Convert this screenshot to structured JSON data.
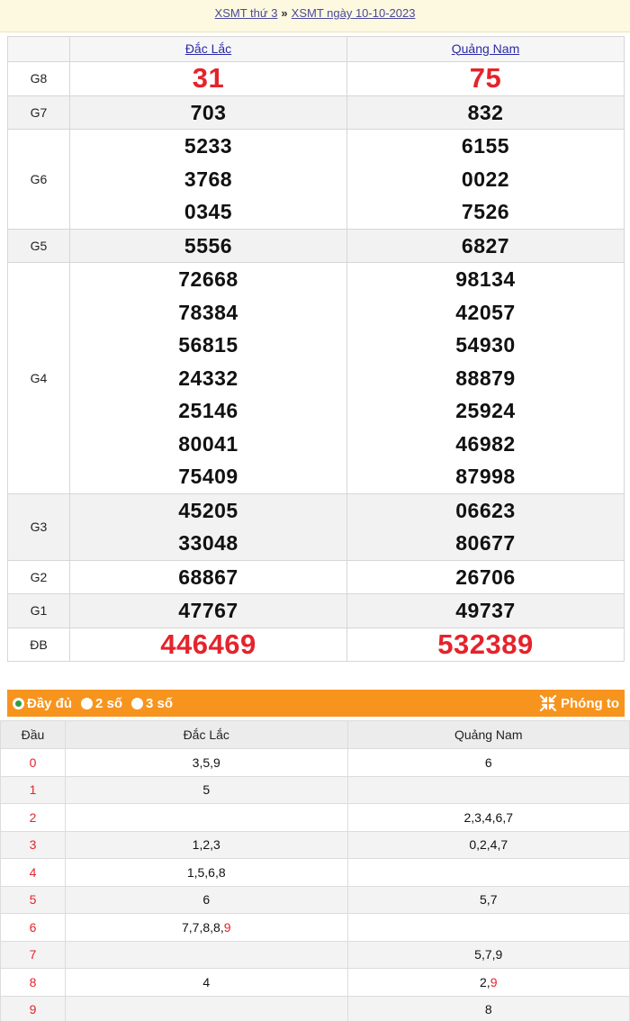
{
  "breadcrumb": {
    "link1": "XSMT thứ 3",
    "separator": "»",
    "link2": "XSMT ngày 10-10-2023"
  },
  "provinces": [
    "Đắc Lắc",
    "Quảng Nam"
  ],
  "prizes": [
    {
      "label": "G8",
      "values": [
        [
          "31"
        ],
        [
          "75"
        ]
      ],
      "highlight": true,
      "alt": false
    },
    {
      "label": "G7",
      "values": [
        [
          "703"
        ],
        [
          "832"
        ]
      ],
      "highlight": false,
      "alt": true
    },
    {
      "label": "G6",
      "values": [
        [
          "5233",
          "3768",
          "0345"
        ],
        [
          "6155",
          "0022",
          "7526"
        ]
      ],
      "highlight": false,
      "alt": false
    },
    {
      "label": "G5",
      "values": [
        [
          "5556"
        ],
        [
          "6827"
        ]
      ],
      "highlight": false,
      "alt": true
    },
    {
      "label": "G4",
      "values": [
        [
          "72668",
          "78384",
          "56815",
          "24332",
          "25146",
          "80041",
          "75409"
        ],
        [
          "98134",
          "42057",
          "54930",
          "88879",
          "25924",
          "46982",
          "87998"
        ]
      ],
      "highlight": false,
      "alt": false
    },
    {
      "label": "G3",
      "values": [
        [
          "45205",
          "33048"
        ],
        [
          "06623",
          "80677"
        ]
      ],
      "highlight": false,
      "alt": true
    },
    {
      "label": "G2",
      "values": [
        [
          "68867"
        ],
        [
          "26706"
        ]
      ],
      "highlight": false,
      "alt": false
    },
    {
      "label": "G1",
      "values": [
        [
          "47767"
        ],
        [
          "49737"
        ]
      ],
      "highlight": false,
      "alt": true
    },
    {
      "label": "ĐB",
      "values": [
        [
          "446469"
        ],
        [
          "532389"
        ]
      ],
      "highlight": true,
      "alt": false
    }
  ],
  "options": {
    "full": "Đầy đủ",
    "two": "2 số",
    "three": "3 số",
    "zoom": "Phóng to",
    "selected": "full"
  },
  "heads_table": {
    "header": "Đầu",
    "provinces": [
      "Đắc Lắc",
      "Quảng Nam"
    ],
    "rows": [
      {
        "dau": "0",
        "cols": [
          [
            "3,5,9"
          ],
          [
            "6"
          ]
        ]
      },
      {
        "dau": "1",
        "cols": [
          [
            "5"
          ],
          []
        ]
      },
      {
        "dau": "2",
        "cols": [
          [],
          [
            "2,3,4,6,7"
          ]
        ]
      },
      {
        "dau": "3",
        "cols": [
          [
            "1,2,3"
          ],
          [
            "0,2,4,7"
          ]
        ]
      },
      {
        "dau": "4",
        "cols": [
          [
            "1,5,6,8"
          ],
          []
        ]
      },
      {
        "dau": "5",
        "cols": [
          [
            "6"
          ],
          [
            "5,7"
          ]
        ]
      },
      {
        "dau": "6",
        "cols": [
          [
            "7,7,8,8,",
            "9"
          ],
          []
        ]
      },
      {
        "dau": "7",
        "cols": [
          [],
          [
            "5,7,9"
          ]
        ]
      },
      {
        "dau": "8",
        "cols": [
          [
            "4"
          ],
          [
            "2,",
            "9"
          ]
        ]
      },
      {
        "dau": "9",
        "cols": [
          [],
          [
            "8"
          ]
        ]
      }
    ]
  },
  "colors": {
    "accent_red": "#e5232b",
    "options_bar": "#f7941d",
    "link": "#2a2aa8"
  }
}
